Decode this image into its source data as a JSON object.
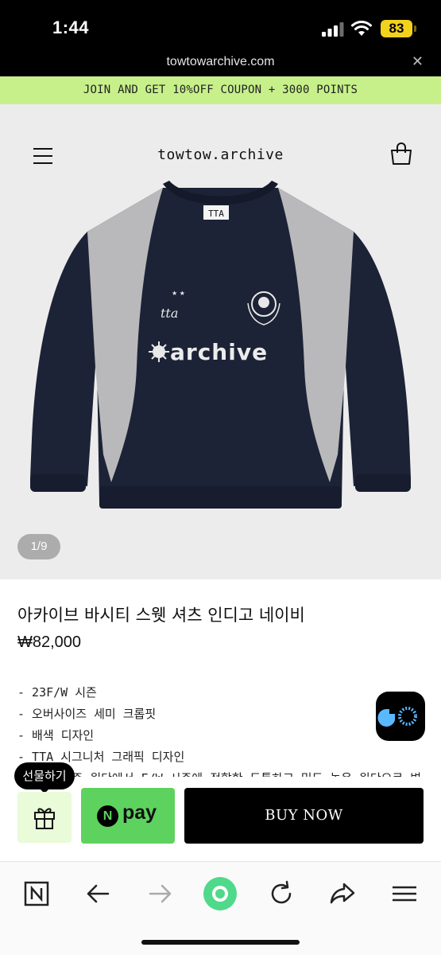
{
  "status_bar": {
    "time": "1:44",
    "battery_level": "83"
  },
  "browser": {
    "url": "towtowarchive.com",
    "close_label": "✕"
  },
  "promo_banner": {
    "text": "JOIN AND GET 10%OFF COUPON + 3000 POINTS"
  },
  "header": {
    "brand": "towtow.archive"
  },
  "product_image": {
    "pager": "1/9",
    "neck_tag": "TTA",
    "chest_script": "tta",
    "chest_wordmark": "archive"
  },
  "product": {
    "title": "아카이브 바시티 스웻 셔츠 인디고 네이비",
    "price": "₩82,000",
    "description": [
      "- 23F/W 시즌",
      "- 오버사이즈 세미 크롭핏",
      "- 배색 디자인",
      "- TTA 시그니처 그래픽 디자인",
      "- 이번 시즌 원단에서 F/W 시즌에 적합한 도톰하고 밀도 높은 원단으로 변"
    ]
  },
  "purchase_bar": {
    "gift_tooltip": "선물하기",
    "npay_letter": "N",
    "npay_label": "pay",
    "buy_now": "BUY NOW"
  },
  "colors": {
    "promo_bg": "#c7f08a",
    "npay_green": "#5ed25e",
    "navy": "#1c2336",
    "heather_grey": "#b9b9bb"
  },
  "bottom_nav": {
    "icons": [
      "n-home-icon",
      "back-arrow-icon",
      "forward-arrow-icon",
      "green-dot-icon",
      "reload-icon",
      "share-icon",
      "menu-icon"
    ]
  }
}
